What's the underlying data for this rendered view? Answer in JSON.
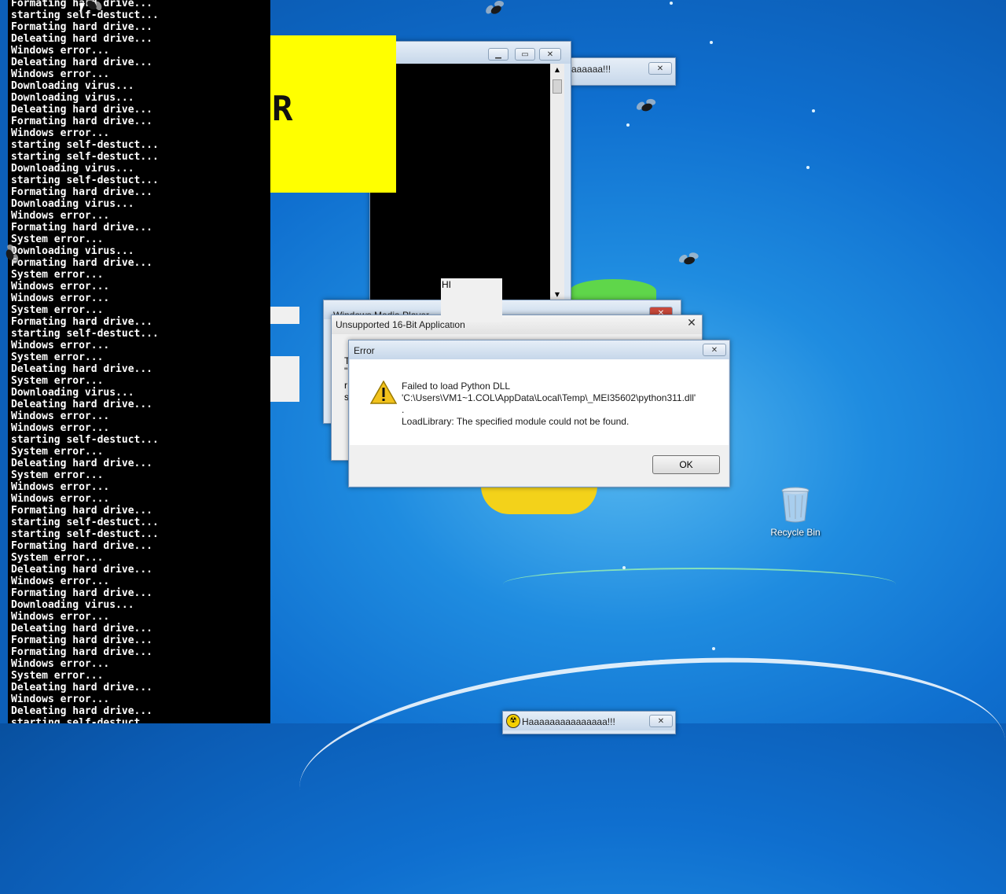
{
  "console": {
    "lines": [
      "Formating hard drive...",
      "starting self-destuct...",
      "Formating hard drive...",
      "Deleating hard drive...",
      "Windows error...",
      "Deleating hard drive...",
      "Windows error...",
      "Downloading virus...",
      "Downloading virus...",
      "Deleating hard drive...",
      "Formating hard drive...",
      "Windows error...",
      "starting self-destuct...",
      "starting self-destuct...",
      "Downloading virus...",
      "starting self-destuct...",
      "Formating hard drive...",
      "Downloading virus...",
      "Windows error...",
      "Formating hard drive...",
      "System error...",
      "Downloading virus...",
      "Formating hard drive...",
      "System error...",
      "Windows error...",
      "Windows error...",
      "System error...",
      "Formating hard drive...",
      "starting self-destuct...",
      "Windows error...",
      "System error...",
      "Deleating hard drive...",
      "System error...",
      "Downloading virus...",
      "Deleating hard drive...",
      "Windows error...",
      "Windows error...",
      "starting self-destuct...",
      "System error...",
      "Deleating hard drive...",
      "System error...",
      "Windows error...",
      "Windows error...",
      "Formating hard drive...",
      "starting self-destuct...",
      "starting self-destuct...",
      "Formating hard drive...",
      "System error...",
      "Deleating hard drive...",
      "Windows error...",
      "Formating hard drive...",
      "Downloading virus...",
      "Windows error...",
      "Deleating hard drive...",
      "Formating hard drive...",
      "Formating hard drive...",
      "Windows error...",
      "System error...",
      "Deleating hard drive...",
      "Windows error...",
      "Deleating hard drive...",
      "starting self-destuct..."
    ]
  },
  "yellow_window": {
    "letter": "R"
  },
  "popup_top": {
    "title": "aaaaaa!!!"
  },
  "popup_bottom": {
    "title": "Haaaaaaaaaaaaaaa!!!"
  },
  "hi_box": {
    "text": "HI"
  },
  "media_player": {
    "title": "Windows Media Player"
  },
  "sixteen_bit": {
    "title": "Unsupported 16-Bit Application",
    "fragments": [
      "T",
      "\"",
      "r",
      "s"
    ]
  },
  "error_dialog": {
    "title": "Error",
    "message": "Failed to load Python DLL\n'C:\\Users\\VM1~1.COL\\AppData\\Local\\Temp\\_MEI35602\\python311.dll'\n.\nLoadLibrary: The specified module could not be found.",
    "ok_label": "OK"
  },
  "desktop": {
    "recycle_bin_label": "Recycle Bin"
  },
  "colors": {
    "console_bg": "#000000",
    "yellow": "#ffff00",
    "desktop_blue": "#1f8ce0"
  }
}
